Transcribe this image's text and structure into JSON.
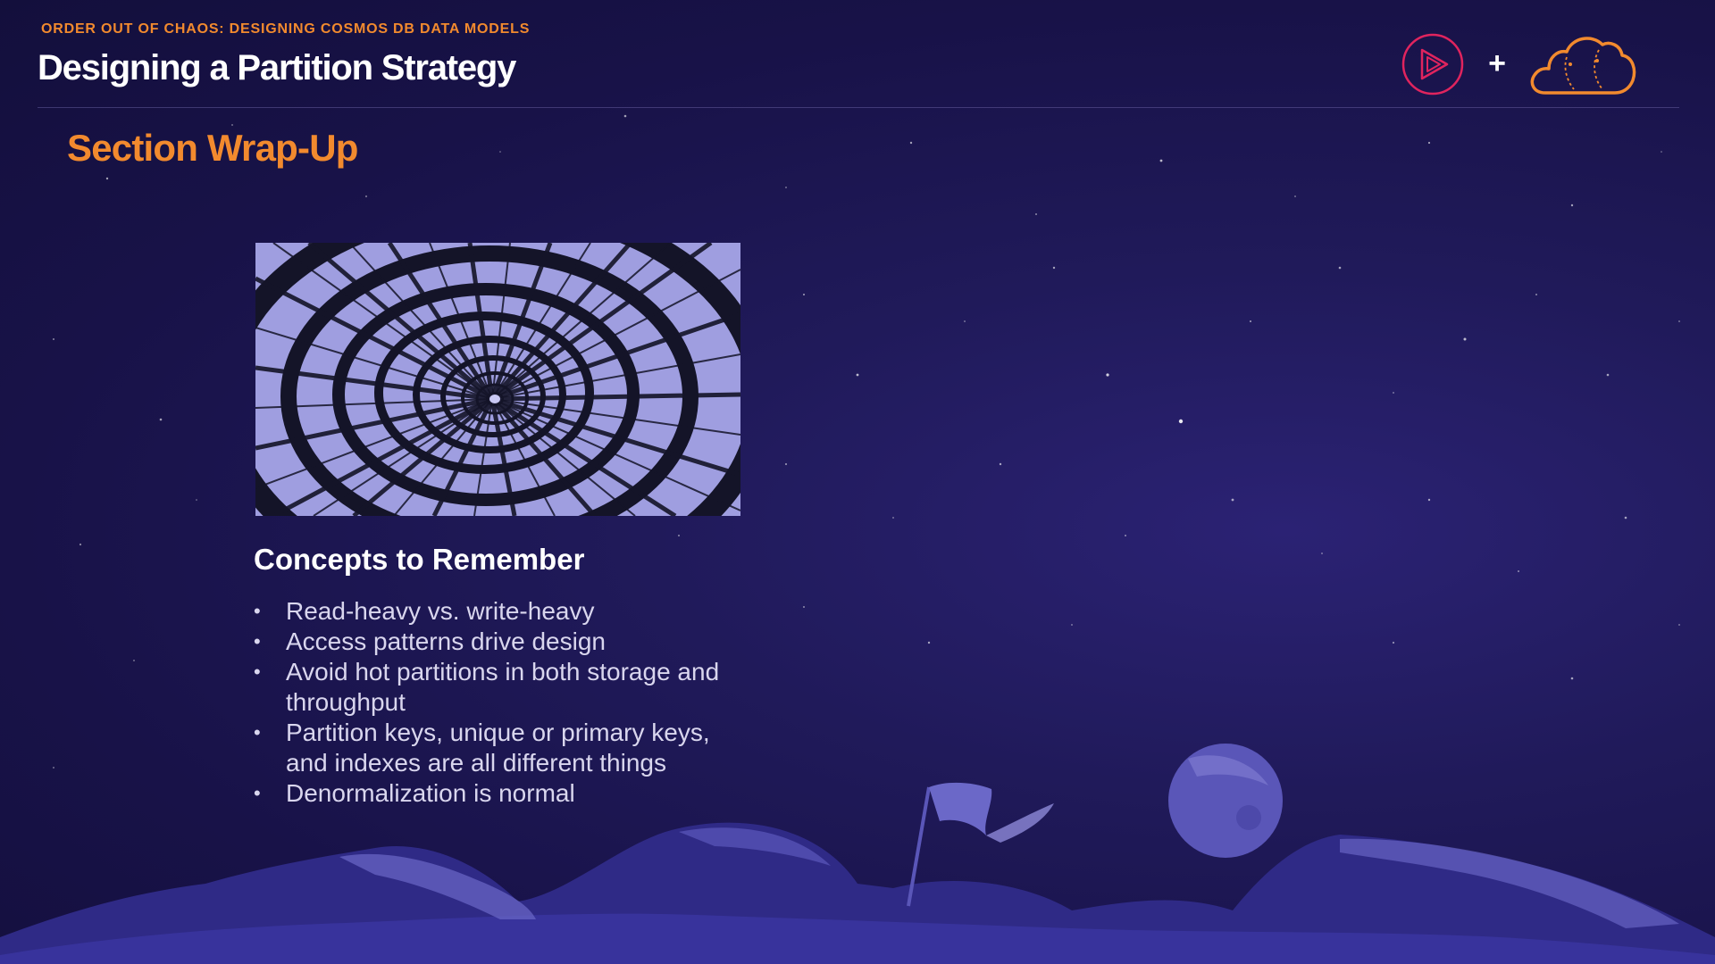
{
  "header": {
    "kicker": "ORDER OUT OF CHAOS: DESIGNING COSMOS DB DATA MODELS",
    "title": "Designing a Partition Strategy"
  },
  "logos": {
    "left": "pluralsight-play-icon",
    "separator": "+",
    "right": "cloud-icon"
  },
  "section": {
    "title": "Section Wrap-Up"
  },
  "concepts": {
    "heading": "Concepts to Remember",
    "items": [
      "Read-heavy vs. write-heavy",
      "Access patterns drive design",
      "Avoid hot partitions in both storage and throughput",
      "Partition keys, unique or primary keys, and indexes are all different things",
      "Denormalization is normal"
    ]
  },
  "colors": {
    "accent": "#f28a2e",
    "background": "#1a1446",
    "logo_play": "#e0245e",
    "heading": "#ffffff",
    "body_text": "#d9d6ee"
  }
}
